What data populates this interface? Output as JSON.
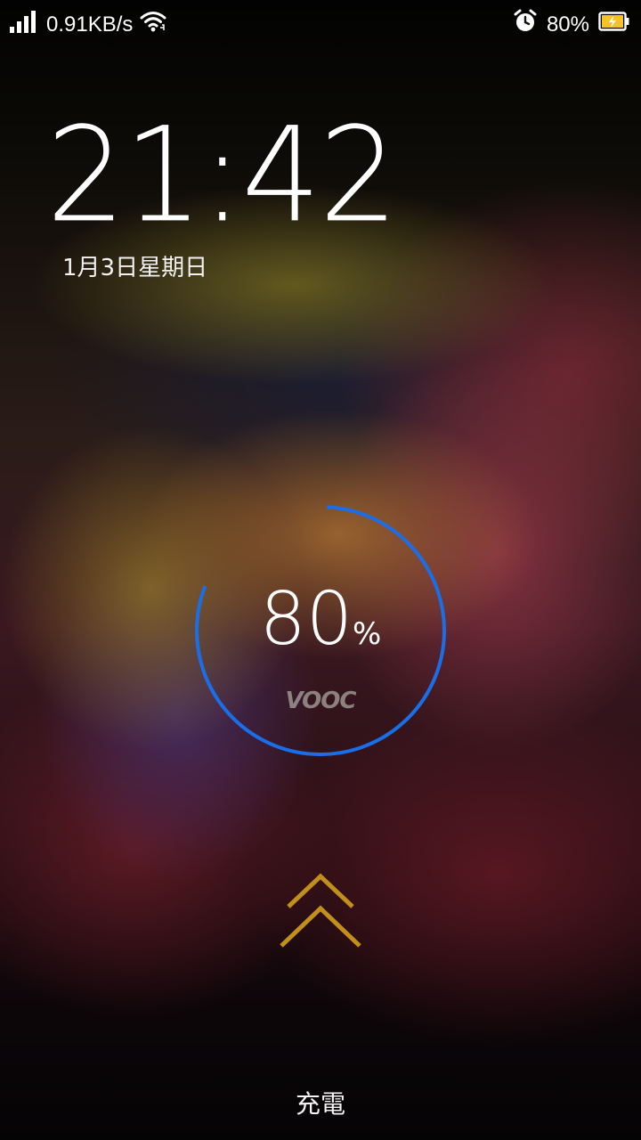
{
  "status_bar": {
    "network_speed": "0.91KB/s",
    "battery_percent_text": "80%",
    "icons": {
      "signal": "signal-bars-icon",
      "wifi": "wifi-icon",
      "alarm": "alarm-clock-icon",
      "battery": "battery-charging-icon"
    }
  },
  "lockscreen": {
    "time": "21:42",
    "date": "1月3日星期日"
  },
  "charging": {
    "percent_value": "80",
    "percent_sign": "%",
    "level_percent": 80,
    "brand_mark": "VOOC",
    "ring_color": "#1a6fe8",
    "label": "充電"
  },
  "unlock_hint": {
    "icon": "double-chevron-up-icon",
    "color": "#c2901a"
  }
}
